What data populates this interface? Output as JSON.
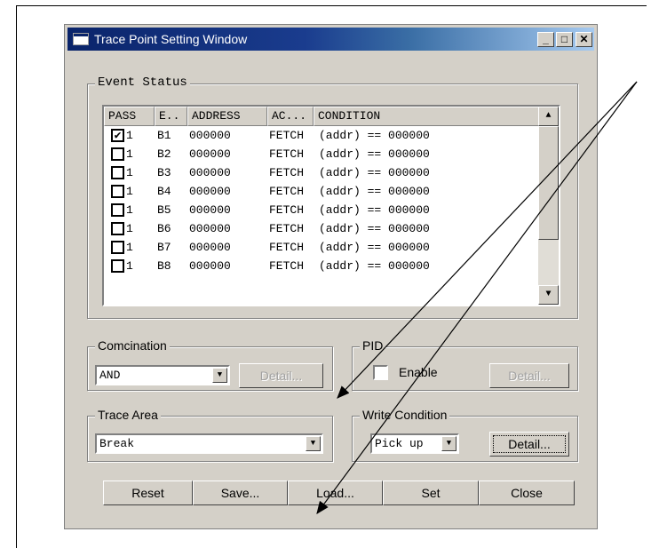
{
  "window": {
    "title": "Trace Point Setting Window"
  },
  "titlebar_buttons": [
    "_",
    "□",
    "✕"
  ],
  "event_status": {
    "label": "Event Status",
    "columns": [
      "PASS",
      "E..",
      "ADDRESS",
      "AC...",
      "CONDITION"
    ],
    "rows": [
      {
        "pass": true,
        "count": "1",
        "event": "B1",
        "address": "000000",
        "access": "FETCH",
        "condition": "(addr) == 000000"
      },
      {
        "pass": false,
        "count": "1",
        "event": "B2",
        "address": "000000",
        "access": "FETCH",
        "condition": "(addr) == 000000"
      },
      {
        "pass": false,
        "count": "1",
        "event": "B3",
        "address": "000000",
        "access": "FETCH",
        "condition": "(addr) == 000000"
      },
      {
        "pass": false,
        "count": "1",
        "event": "B4",
        "address": "000000",
        "access": "FETCH",
        "condition": "(addr) == 000000"
      },
      {
        "pass": false,
        "count": "1",
        "event": "B5",
        "address": "000000",
        "access": "FETCH",
        "condition": "(addr) == 000000"
      },
      {
        "pass": false,
        "count": "1",
        "event": "B6",
        "address": "000000",
        "access": "FETCH",
        "condition": "(addr) == 000000"
      },
      {
        "pass": false,
        "count": "1",
        "event": "B7",
        "address": "000000",
        "access": "FETCH",
        "condition": "(addr) == 000000"
      },
      {
        "pass": false,
        "count": "1",
        "event": "B8",
        "address": "000000",
        "access": "FETCH",
        "condition": "(addr) == 000000"
      }
    ]
  },
  "combination": {
    "label": "Comcination",
    "value": "AND",
    "detail_label": "Detail..."
  },
  "pid": {
    "label": "PID",
    "enable_label": "Enable",
    "detail_label": "Detail..."
  },
  "trace_area": {
    "label": "Trace Area",
    "value": "Break"
  },
  "write_condition": {
    "label": "Write Condition",
    "value": "Pick up",
    "detail_label": "Detail..."
  },
  "footer": {
    "reset": "Reset",
    "save": "Save...",
    "load": "Load...",
    "set": "Set",
    "close": "Close"
  },
  "icons": {
    "check": "✔",
    "arrow_up": "▲",
    "arrow_down": "▼"
  }
}
